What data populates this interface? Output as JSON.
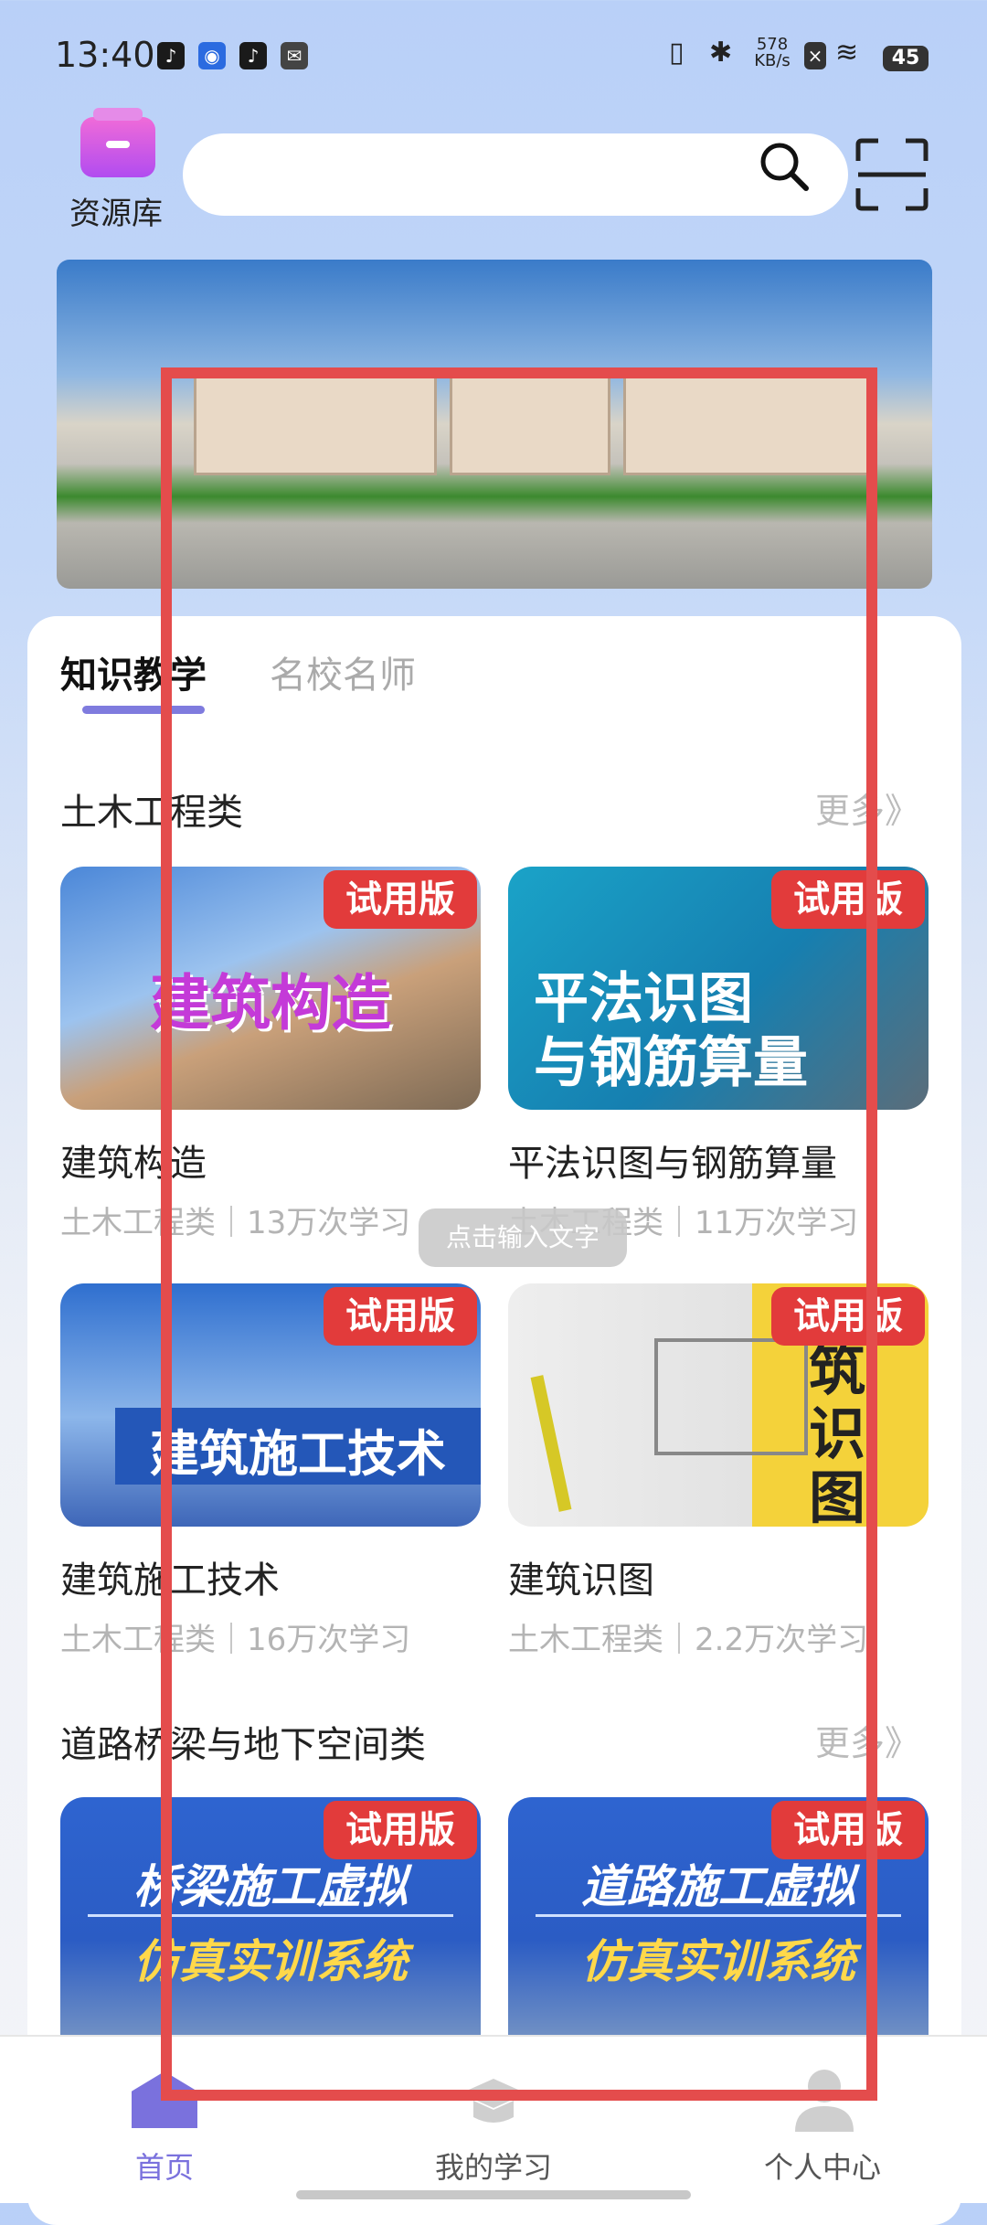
{
  "status_bar": {
    "time": "13:40",
    "speed": "578",
    "speed_unit": "KB/s",
    "battery": "45"
  },
  "header": {
    "library_label": "资源库",
    "search_value": ""
  },
  "tabs": [
    {
      "label": "知识教学"
    },
    {
      "label": "名校名师"
    }
  ],
  "sections": [
    {
      "title": "土木工程类",
      "more": "更多》",
      "courses": [
        {
          "thumb_text": "建筑构造",
          "badge": "试用版",
          "title": "建筑构造",
          "meta": "土木工程类｜13万次学习"
        },
        {
          "thumb_text_1": "平法识图",
          "thumb_text_2": "与钢筋算量",
          "badge": "试用版",
          "title": "平法识图与钢筋算量",
          "meta": "土木工程类｜11万次学习"
        },
        {
          "thumb_text": "建筑施工技术",
          "badge": "试用版",
          "title": "建筑施工技术",
          "meta": "土木工程类｜16万次学习"
        },
        {
          "thumb_text": "筑 识 图",
          "badge": "试用版",
          "title": "建筑识图",
          "meta": "土木工程类｜2.2万次学习"
        }
      ]
    },
    {
      "title": "道路桥梁与地下空间类",
      "more": "更多》",
      "courses": [
        {
          "thumb_text_1": "桥梁施工虚拟",
          "thumb_text_2": "仿真实训系统",
          "badge": "试用版"
        },
        {
          "thumb_text_1": "道路施工虚拟",
          "thumb_text_2": "仿真实训系统",
          "badge": "试用版"
        }
      ]
    }
  ],
  "tooltip": "点击输入文字",
  "bottom_nav": [
    {
      "label": "首页",
      "active": true
    },
    {
      "label": "我的学习",
      "active": false
    },
    {
      "label": "个人中心",
      "active": false
    }
  ],
  "colors": {
    "accent": "#7a71dd",
    "badge": "#e23b3b",
    "highlight_box": "#e44c4c"
  }
}
